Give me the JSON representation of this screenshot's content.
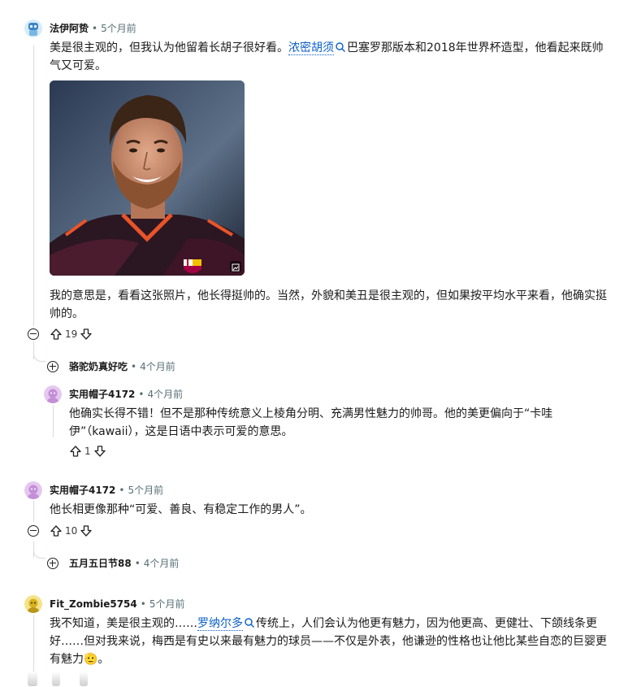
{
  "comments": [
    {
      "user": "法伊阿贽",
      "time": "5个月前",
      "body_parts": {
        "pre": "美是很主观的，但我认为他留着长胡子很好看。",
        "link": "浓密胡须",
        "post": "巴塞罗那版本和2018年世界杯造型，他看起来既帅气又可爱。"
      },
      "body2": "我的意思是，看看这张照片，他长得挺帅的。当然，外貌和美丑是很主观的，但如果按平均水平来看，他确实挺帅的。",
      "votes": "19"
    },
    {
      "user": "骆驼奶真好吃",
      "time": "4个月前",
      "collapsed": true
    },
    {
      "user": "实用帽子4172",
      "time": "4个月前",
      "body": "他确实长得不错！但不是那种传统意义上棱角分明、充满男性魅力的帅哥。他的美更偏向于“卡哇伊”（kawaii），这是日语中表示可爱的意思。",
      "votes": "1"
    },
    {
      "user": "实用帽子4172",
      "time": "5个月前",
      "body": "他长相更像那种“可爱、善良、有稳定工作的男人”。",
      "votes": "10"
    },
    {
      "user": "五月五日节88",
      "time": "4个月前",
      "collapsed": true
    },
    {
      "user": "Fit_Zombie5754",
      "time": "5个月前",
      "body_parts": {
        "pre": "我不知道，美是很主观的……",
        "link": "罗纳尔多",
        "post": "传统上，人们会认为他更有魅力，因为他更高、更健壮、下颌线条更好……但对我来说，梅西是有史以来最有魅力的球员——不仅是外表，他谦逊的性格也让他比某些自恋的巨婴更有魅力🫡。"
      }
    }
  ],
  "separator": "•",
  "colors": {
    "link": "#0a5ec9",
    "meta": "#576f76",
    "thread_line": "#d7dadc"
  },
  "icons": [
    "user-avatar-icon",
    "search-icon",
    "upvote-icon",
    "downvote-icon",
    "collapse-icon",
    "expand-icon",
    "image-expand-icon"
  ]
}
